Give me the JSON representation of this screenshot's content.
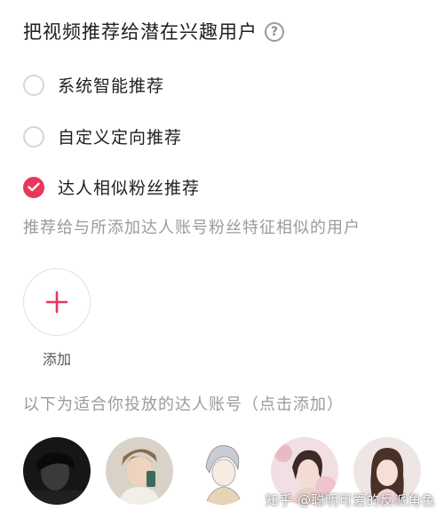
{
  "header": {
    "title": "把视频推荐给潜在兴趣用户",
    "help_icon": "question-circle-icon"
  },
  "options": [
    {
      "label": "系统智能推荐",
      "checked": false
    },
    {
      "label": "自定义定向推荐",
      "checked": false
    },
    {
      "label": "达人相似粉丝推荐",
      "checked": true
    }
  ],
  "description": "推荐给与所添加达人账号粉丝特征相似的用户",
  "add": {
    "icon": "plus-icon",
    "label": "添加"
  },
  "suggest_hint": "以下为适合你投放的达人账号（点击添加）",
  "watermark": "知乎 @聪明可爱的反派角色",
  "colors": {
    "accent": "#e8375a",
    "text_primary": "#1f1f1f",
    "text_secondary": "#9b9b9b",
    "radio_border": "#d6d6d6"
  }
}
